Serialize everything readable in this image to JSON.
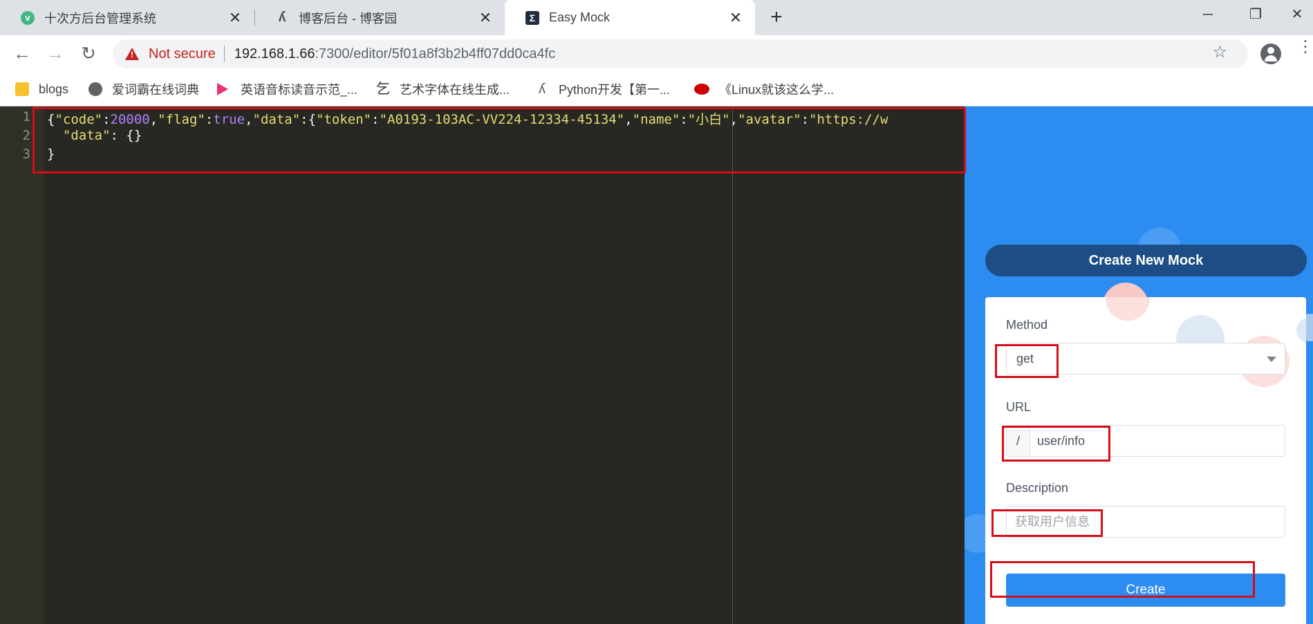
{
  "browser": {
    "tabs": [
      {
        "title": "十次方后台管理系统",
        "favicon": "vue-icon",
        "favicon_color": "#41b883"
      },
      {
        "title": "博客后台 - 博客园",
        "favicon": "cnblogs-icon",
        "favicon_color": "#555555"
      },
      {
        "title": "Easy Mock",
        "favicon": "easy-mock-icon",
        "favicon_color": "#1f2d3d"
      }
    ],
    "active_tab": 2,
    "new_tab_symbol": "+",
    "close_symbol": "✕",
    "window_controls": {
      "minimize": "─",
      "restore": "❐",
      "close": "✕"
    }
  },
  "toolbar": {
    "back": "←",
    "forward": "→",
    "reload": "↻",
    "security_label": "Not secure",
    "url_host": "192.168.1.66",
    "url_rest": ":7300/editor/5f01a8f3b2b4ff07dd0ca4fc",
    "star": "☆",
    "menu": "⋮"
  },
  "bookmarks": [
    {
      "label": "blogs",
      "icon": "folder-icon",
      "color": "#f6c12b"
    },
    {
      "label": "爱词霸在线词典",
      "icon": "globe-icon",
      "color": "#5f6368"
    },
    {
      "label": "英语音标读音示范_...",
      "icon": "play-icon",
      "color": "#e8336f"
    },
    {
      "label": "艺术字体在线生成...",
      "icon": "art-icon",
      "color": "#333333"
    },
    {
      "label": "Python开发【第一...",
      "icon": "cnblogs-icon",
      "color": "#555555"
    },
    {
      "label": "《Linux就该这么学...",
      "icon": "redhat-icon",
      "color": "#cc0000"
    }
  ],
  "editor": {
    "line_numbers": [
      "1",
      "2",
      "3"
    ],
    "line1": {
      "t1": "{",
      "k_code": "\"code\"",
      "c1": ":",
      "v_code": "20000",
      "c2": ",",
      "k_flag": "\"flag\"",
      "c3": ":",
      "v_flag": "true",
      "c4": ",",
      "k_data": "\"data\"",
      "c5": ":{",
      "k_token": "\"token\"",
      "c6": ":",
      "v_token": "\"A0193-103AC-VV224-12334-45134\"",
      "c7": ",",
      "k_name": "\"name\"",
      "c8": ":",
      "v_name": "\"小白\"",
      "c9": ",",
      "k_avatar": "\"avatar\"",
      "c10": ":",
      "v_avatar": "\"https://w"
    },
    "line2": {
      "key": "\"data\"",
      "rest": ": {}"
    },
    "line3": "}"
  },
  "panel": {
    "create_new_mock": "Create New Mock",
    "method_label": "Method",
    "method_value": "get",
    "url_label": "URL",
    "url_prefix": "/",
    "url_value": "user/info",
    "description_label": "Description",
    "description_value": "获取用户信息",
    "create_button": "Create"
  },
  "colors": {
    "accent": "#2d8cf0",
    "dark_button": "#1c4d85",
    "annotation": "#d80c18",
    "editor_bg": "#272822"
  }
}
